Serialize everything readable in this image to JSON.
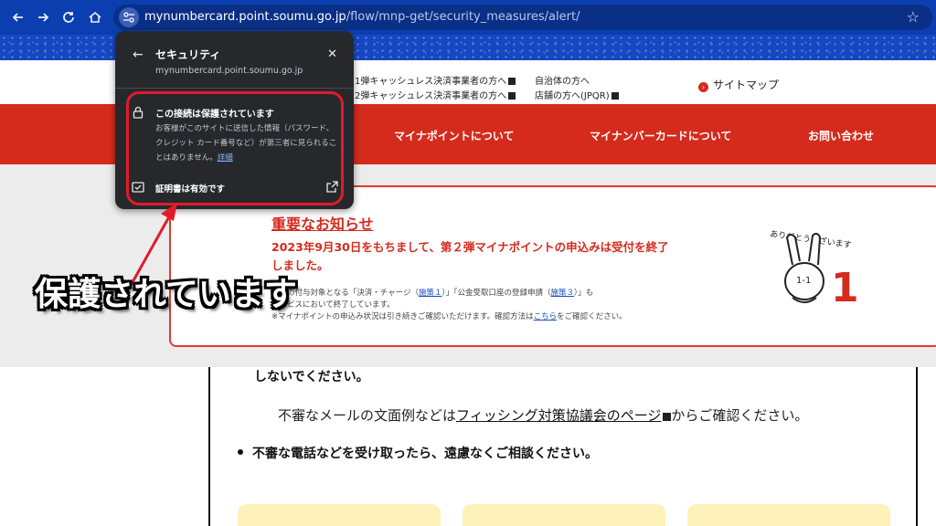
{
  "browser": {
    "url_host": "mynumbercard.point.soumu.go.jp",
    "url_path": "/flow/mnp-get/security_measures/alert/",
    "icons": [
      "back-icon",
      "forward-icon",
      "reload-icon",
      "home-icon",
      "site-info-icon",
      "star-icon"
    ]
  },
  "utility": {
    "link1": "1弾キャッシュレス決済事業者の方へ",
    "link2": "2弾キャッシュレス決済事業者の方へ",
    "link3": "自治体の方へ",
    "link4": "店舗の方へ(JPQR)",
    "sitemap": "サイトマップ"
  },
  "nav": {
    "item1": "マイナポイントについて",
    "item2": "マイナンバーカードについて",
    "item3": "お問い合わせ"
  },
  "notice": {
    "title": "重要なお知らせ",
    "main_line1": "2023年9月30日をもちまして、第２弾マイナポイントの申込みは受付を終了",
    "main_line2": "しました。",
    "sub_line1_a": "ントの付与対象となる「決済・チャージ（",
    "sub_link1": "施策１",
    "sub_line1_b": "）」「公金受取口座の登録申請（",
    "sub_link2": "施策３",
    "sub_line1_c": "）」も",
    "sub_line2": "サービスにおいて終了しています。",
    "sub_line3_a": "※マイナポイントの申込み状況は引き続きご確認いただけます。確認方法は",
    "sub_link3": "こちら",
    "sub_line3_b": "をご確認ください。",
    "mascot_caption": "ありがとうございます",
    "mascot_number": "1"
  },
  "content": {
    "line1": "しないでください。",
    "line2_a": "不審なメールの文面例などは",
    "line2_link": "フィッシング対策協議会のページ",
    "line2_b": "からご確認ください。",
    "bullet": "不審な電話などを受け取ったら、遠慮なくご相談ください。"
  },
  "popup": {
    "title": "セキュリティ",
    "host": "mynumbercard.point.soumu.go.jp",
    "connection": "この接続は保護されています",
    "desc": "お客様がこのサイトに送信した情報（パスワード、クレジット カード番号など）が第三者に見られることはありません。",
    "details_link": "詳細",
    "certificate": "証明書は有効です"
  },
  "annotation": {
    "callout": "保護されています",
    "color": "#e11b2a"
  },
  "colors": {
    "brand_red": "#d42b1d",
    "chrome_blue": "#0b3fb0",
    "popup_bg": "#26282c",
    "link_blue": "#8ab4f8"
  }
}
